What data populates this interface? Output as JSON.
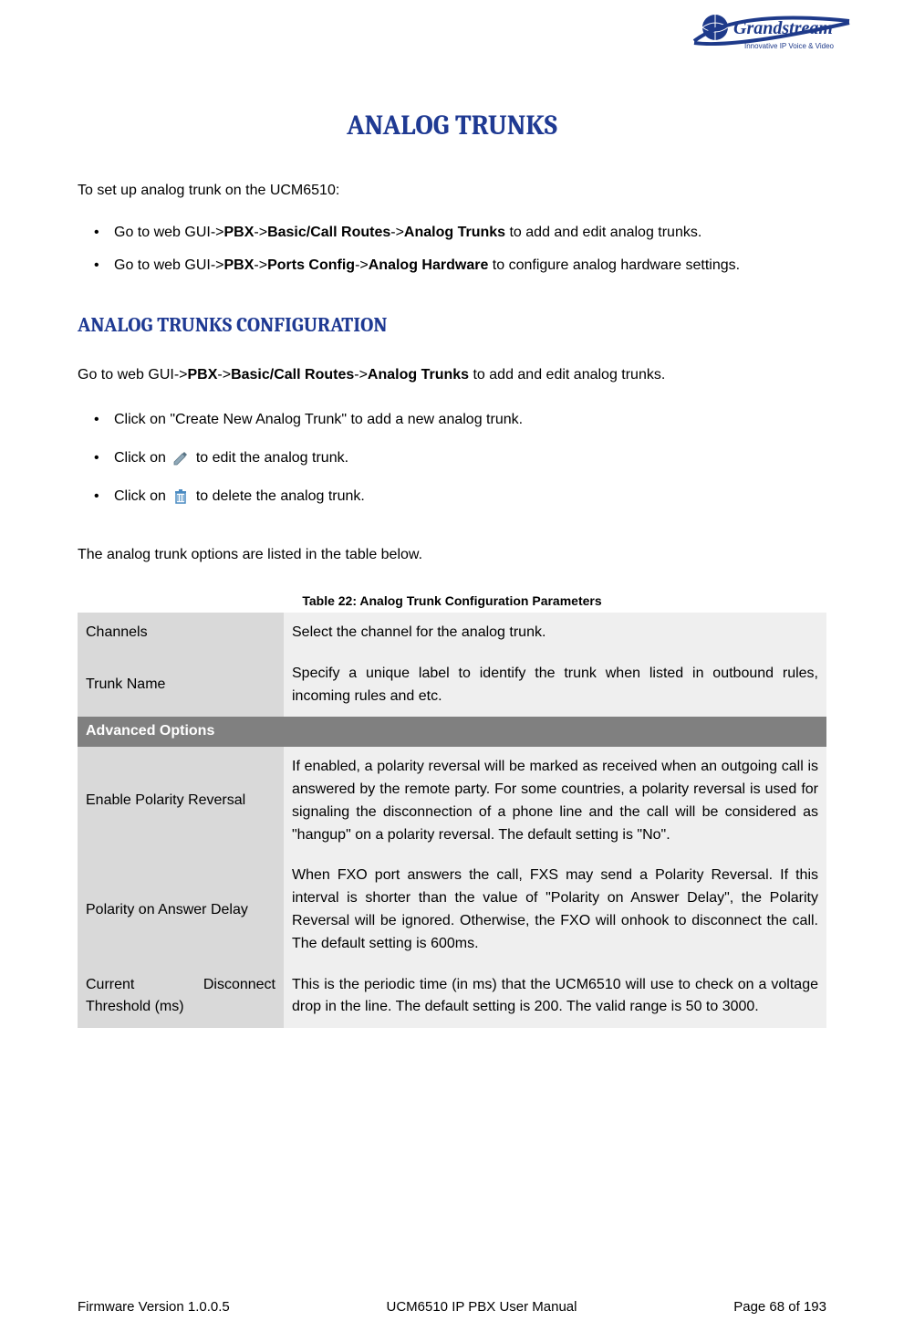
{
  "logo": {
    "brand": "Grandstream",
    "tagline": "Innovative IP Voice & Video"
  },
  "title": "ANALOG TRUNKS",
  "intro": "To set up analog trunk on the UCM6510:",
  "bullets_intro": [
    {
      "prefix": "Go to web GUI->",
      "b1": "PBX",
      "s1": "->",
      "b2": "Basic/Call Routes",
      "s2": "->",
      "b3": "Analog Trunks",
      "suffix": " to add and edit analog trunks."
    },
    {
      "prefix": "Go to web GUI->",
      "b1": "PBX",
      "s1": "->",
      "b2": "Ports Config",
      "s2": "->",
      "b3": "Analog Hardware",
      "suffix": " to configure analog hardware settings."
    }
  ],
  "section_title": "ANALOG TRUNKS CONFIGURATION",
  "section_intro": {
    "prefix": "Go to web GUI->",
    "b1": "PBX",
    "s1": "->",
    "b2": "Basic/Call Routes",
    "s2": "->",
    "b3": "Analog Trunks",
    "suffix": " to add and edit analog trunks."
  },
  "bullets_steps": {
    "create": "Click on \"Create New Analog Trunk\" to add a new analog trunk.",
    "edit_pre": "Click on ",
    "edit_post": " to edit the analog trunk.",
    "delete_pre": "Click on ",
    "delete_post": " to delete the analog trunk."
  },
  "para_below": "The analog trunk options are listed in the table below.",
  "table_caption": "Table 22: Analog Trunk Configuration Parameters",
  "table": {
    "rows": [
      {
        "k": "Channels",
        "v": "Select the channel for the analog trunk."
      },
      {
        "k": "Trunk Name",
        "v": "Specify a unique label to identify the trunk when listed in outbound rules, incoming rules and etc."
      }
    ],
    "section": "Advanced Options",
    "rows2": [
      {
        "k": "Enable Polarity Reversal",
        "v": "If enabled, a polarity reversal will be marked as received when an outgoing call is answered by the remote party. For some countries, a polarity reversal is used for signaling the disconnection of a phone line and the call will be considered as \"hangup\" on a polarity reversal. The default setting is \"No\"."
      },
      {
        "k": "Polarity on Answer Delay",
        "v": "When FXO port answers the call, FXS may send a Polarity Reversal. If this interval is shorter than the value of \"Polarity on Answer Delay\", the Polarity Reversal will be ignored. Otherwise, the FXO will onhook to disconnect the call. The default setting is 600ms."
      },
      {
        "k": "Current Disconnect Threshold (ms)",
        "v": "This is the periodic time (in ms) that the UCM6510 will use to check on a voltage drop in the line. The default setting is 200. The valid range is 50 to 3000."
      }
    ]
  },
  "footer": {
    "left": "Firmware Version 1.0.0.5",
    "center": "UCM6510 IP PBX User Manual",
    "right": "Page 68 of 193"
  }
}
